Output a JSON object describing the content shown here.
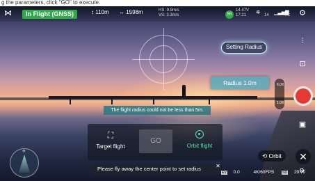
{
  "caption": "g the parameters, click \"GO\" to execute.",
  "status_bar": {
    "flight_mode": "In Flight (GNSS)",
    "altitude": "110m",
    "distance": "1598m",
    "hs": "HS: 9.9m/s",
    "vs": "VS: 3.3m/s",
    "battery_percent": "55",
    "battery_voltage": "14.47V",
    "battery_time": "17:21",
    "gps_count": "14",
    "rc_label": "RC"
  },
  "radius": {
    "setting_label": "Setting Radius",
    "value_label": "Radius  1.0m"
  },
  "zoom": {
    "top": "6.0X",
    "bottom": "1.0X"
  },
  "toast": "The flight radius could not be less than 5m.",
  "panel": {
    "target_label": "Target flight",
    "go_label": "GO",
    "orbit_label": "Orbit flight"
  },
  "hint": "Please fly away the center point to set radius",
  "orbit_button": "Orbit",
  "bottom_status": {
    "ev": "0.0",
    "resolution": "4K/60FPS",
    "storage": "29.70",
    "ev_tag": "EV",
    "sd_tag": "SD"
  },
  "colors": {
    "mode_green": "#2eaa47",
    "shutter_red": "#e53935",
    "orbit_green": "#58e0a6",
    "radius_teal": "#50aabe"
  }
}
